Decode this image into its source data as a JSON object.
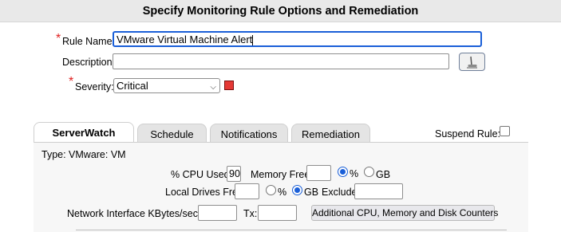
{
  "header": {
    "title": "Specify Monitoring Rule Options and Remediation"
  },
  "form": {
    "required_mark": "*",
    "rule_name_label": "Rule Name:",
    "rule_name_value": "VMware Virtual Machine Alert",
    "description_label": "Description:",
    "description_value": "",
    "severity_label": "Severity:",
    "severity_value": "Critical",
    "severity_color": "#e53935"
  },
  "tabs": [
    {
      "label": "ServerWatch",
      "active": true
    },
    {
      "label": "Schedule",
      "active": false
    },
    {
      "label": "Notifications",
      "active": false
    },
    {
      "label": "Remediation",
      "active": false
    }
  ],
  "suspend": {
    "label": "Suspend Rule:",
    "checked": false
  },
  "panel": {
    "type_text": "Type: VMware: VM",
    "cpu_label": "% CPU Used:",
    "cpu_value": "90",
    "memory_label": "Memory Free:",
    "memory_value": "",
    "memory_unit_percent": "%",
    "memory_unit_gb": "GB",
    "memory_unit_selected": "%",
    "drives_label": "Local Drives Free:",
    "drives_value": "",
    "drives_unit_percent": "%",
    "drives_unit_gb": "GB",
    "drives_unit_selected": "GB",
    "exclude_label": "Exclude:",
    "exclude_value": "",
    "network_label": "Network Interface KBytes/sec, Rx:",
    "rx_value": "",
    "tx_label": "Tx:",
    "tx_value": "",
    "additional_button": "Additional CPU, Memory and Disk Counters"
  }
}
